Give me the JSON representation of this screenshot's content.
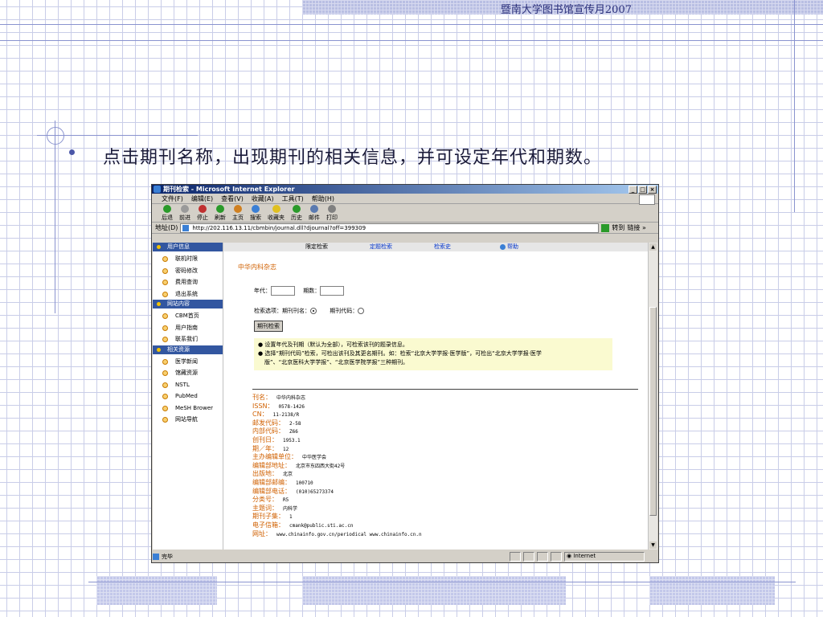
{
  "slide": {
    "header_title": "暨南大学图书馆宣传月2007",
    "headline": "点击期刊名称，出现期刊的相关信息，并可设定年代和期数。"
  },
  "window": {
    "title": "期刊检索 - Microsoft Internet Explorer",
    "minimize": "_",
    "maximize": "□",
    "close": "×",
    "menu": [
      "文件(F)",
      "编辑(E)",
      "查看(V)",
      "收藏(A)",
      "工具(T)",
      "帮助(H)"
    ],
    "toolbar": [
      {
        "label": "后退",
        "icon": "back-icon",
        "color": "#2a9a2a"
      },
      {
        "label": "前进",
        "icon": "forward-icon",
        "color": "#9a9a9a"
      },
      {
        "label": "停止",
        "icon": "stop-icon",
        "color": "#c03030"
      },
      {
        "label": "刷新",
        "icon": "refresh-icon",
        "color": "#2a9a2a"
      },
      {
        "label": "主页",
        "icon": "home-icon",
        "color": "#d08020"
      },
      {
        "label": "搜索",
        "icon": "search-icon",
        "color": "#3a7fd5"
      },
      {
        "label": "收藏夹",
        "icon": "favorites-icon",
        "color": "#e0c020"
      },
      {
        "label": "历史",
        "icon": "history-icon",
        "color": "#2a9a2a"
      },
      {
        "label": "邮件",
        "icon": "mail-icon",
        "color": "#5a7ab0"
      },
      {
        "label": "打印",
        "icon": "print-icon",
        "color": "#808080"
      }
    ],
    "address_label": "地址(D)",
    "address_url": "http://202.116.13.11/cbmbin/journal.dll?djournal?off=399309",
    "go_label": "转到",
    "links_label": "链接 »",
    "status_text": "完毕",
    "zone_text": "Internet"
  },
  "sidebar": {
    "sections": [
      {
        "title": "用户信息",
        "items": [
          "联机时限",
          "密码修改",
          "费用查询",
          "退出系统"
        ]
      },
      {
        "title": "网站内容",
        "items": [
          "CBM首页",
          "用户指南",
          "联系我们"
        ]
      },
      {
        "title": "相关资源",
        "items": [
          "医学新闻",
          "馆藏资源",
          "NSTL",
          "PubMed",
          "MeSH Brower",
          "网站导航"
        ]
      }
    ]
  },
  "tabs": [
    "限定检索",
    "定题检索",
    "检索史",
    "帮助"
  ],
  "page": {
    "journal_title": "中华内科杂志",
    "year_label": "年代：",
    "issue_label": "期数：",
    "option_label": "检索选项：期刊刊名：",
    "option2_label": "期刊代码：",
    "search_button": "期刊检索",
    "tips": [
      "设置年代及刊期（默认为全部），可检索该刊的题录信息。",
      "选择“期刊代码”检索，可检出该刊及其更名期刊。如：检索“北京大学学报·医学版”，可检出“北京大学学报·医学",
      "版”、“北京医科大学学报”、“北京医学院学报”三种期刊。"
    ],
    "details": [
      {
        "k": "刊名：",
        "v": "中华内科杂志"
      },
      {
        "k": "ISSN：",
        "v": "0578-1426"
      },
      {
        "k": "CN：",
        "v": "11-2138/R"
      },
      {
        "k": "邮发代码：",
        "v": "2-58"
      },
      {
        "k": "内部代码：",
        "v": "Z66"
      },
      {
        "k": "创刊日：",
        "v": "1953.1"
      },
      {
        "k": "期／年：",
        "v": "12"
      },
      {
        "k": "主办编辑单位：",
        "v": "中华医学会"
      },
      {
        "k": "编辑部地址：",
        "v": "北京市东四西大街42号"
      },
      {
        "k": "出版地：",
        "v": "北京"
      },
      {
        "k": "编辑部邮编：",
        "v": "100710"
      },
      {
        "k": "编辑部电话：",
        "v": "(010)65273374"
      },
      {
        "k": "分类号：",
        "v": "R5"
      },
      {
        "k": "主题词：",
        "v": "内科学"
      },
      {
        "k": "期刊子集：",
        "v": "1"
      },
      {
        "k": "电子信箱：",
        "v": "cmank@public.sti.ac.cn"
      },
      {
        "k": "网址：",
        "v": "www.chinainfo.gov.cn/periodical www.chinainfo.cn.n"
      }
    ]
  }
}
